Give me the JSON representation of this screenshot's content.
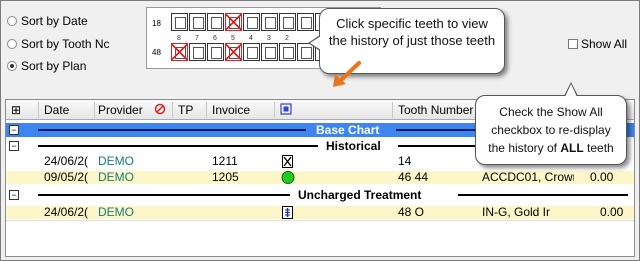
{
  "sort_options": [
    {
      "label": "Sort by Date",
      "checked": false
    },
    {
      "label": "Sort by Tooth Nc",
      "checked": false
    },
    {
      "label": "Sort by Plan",
      "checked": true
    }
  ],
  "tooth_chart": {
    "upper_label": "18",
    "lower_label": "48",
    "numbers": [
      "8",
      "7",
      "6",
      "5",
      "4",
      "3",
      "2"
    ],
    "upper_selected": [
      3
    ],
    "lower_selected": [
      0,
      3
    ]
  },
  "callout_top": "Click specific teeth to view the history of just those teeth",
  "callout_right": {
    "prefix": "Check the Show All checkbox to re-display the history of ",
    "bold": "ALL",
    "suffix": " teeth"
  },
  "show_all": {
    "label": "Show All",
    "checked": false
  },
  "grid": {
    "columns": {
      "expand": "⊞",
      "date": "Date",
      "provider": "Provider",
      "flag_icon": "no-entry-icon",
      "tp": "TP",
      "invoice": "Invoice",
      "status_icon": "square-status-icon",
      "tooth": "Tooth Number"
    },
    "groups": {
      "base": "Base Chart",
      "historical": "Historical",
      "uncharged": "Uncharged Treatment"
    },
    "rows": [
      {
        "date": "24/06/2(",
        "provider": "DEMO",
        "invoice": "1211",
        "icon": "crossed-box-icon",
        "tooth": "14",
        "desc": "",
        "amount": ""
      },
      {
        "date": "09/05/2(",
        "provider": "DEMO",
        "invoice": "1205",
        "icon": "green-circle-icon",
        "tooth": "46  44",
        "desc": "ACCDC01, Crown",
        "amount": "0.00"
      },
      {
        "date": "24/06/2(",
        "provider": "DEMO",
        "invoice": "",
        "icon": "implant-icon",
        "tooth": "48 O",
        "desc": "IN-G, Gold Ir",
        "amount": "0.00"
      }
    ]
  },
  "colors": {
    "accent_blue": "#3d86f0",
    "highlight_yellow": "#fdf6c8",
    "provider_teal": "#1a7a7a",
    "tooth_red": "#dd2222",
    "status_green": "#22cc22",
    "arrow_orange": "#e8751a"
  }
}
